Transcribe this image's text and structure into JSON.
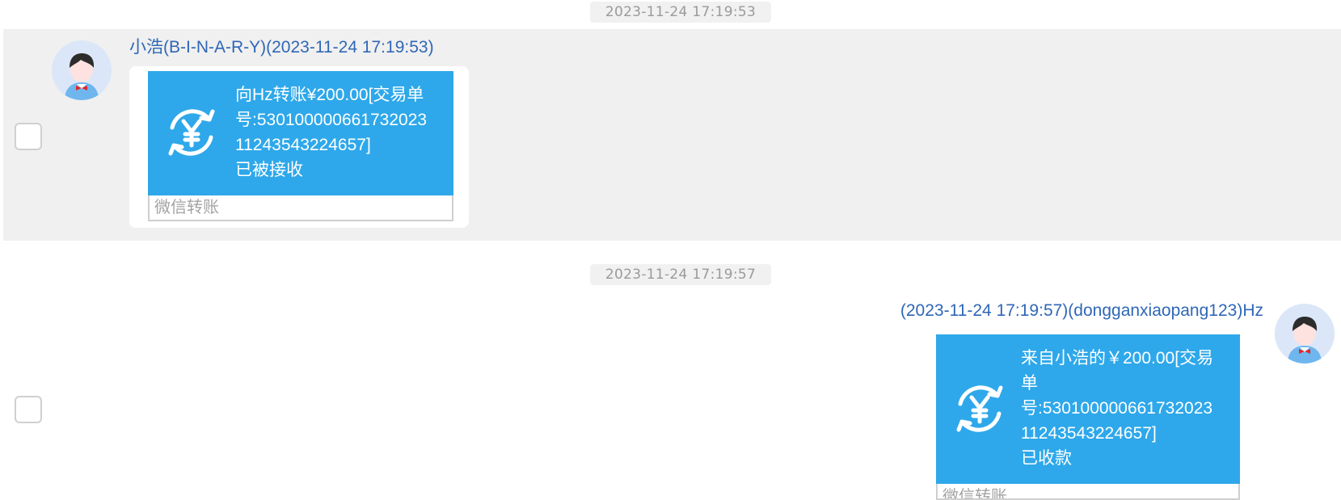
{
  "messages": [
    {
      "timestamp": "2023-11-24 17:19:53",
      "sender": "小浩(B-I-N-A-R-Y)(2023-11-24 17:19:53)",
      "transfer": {
        "lines": [
          "向Hz转账¥200.00[交易单",
          "号:530100000661732023",
          "11243543224657]",
          "已被接收"
        ],
        "footer": "微信转账"
      },
      "icon": "yuan-transfer-icon"
    },
    {
      "timestamp": "2023-11-24 17:19:57",
      "sender": "(2023-11-24 17:19:57)(dongganxiaopang123)Hz",
      "transfer": {
        "lines": [
          "来自小浩的￥200.00[交易",
          "单",
          "号:530100000661732023",
          "11243543224657]",
          "已收款"
        ],
        "footer": "微信转账"
      },
      "icon": "yuan-transfer-icon"
    }
  ],
  "colors": {
    "card_blue": "#2ea8ea",
    "sender_blue": "#2f67b6",
    "row_highlight": "#f0f0f0"
  }
}
